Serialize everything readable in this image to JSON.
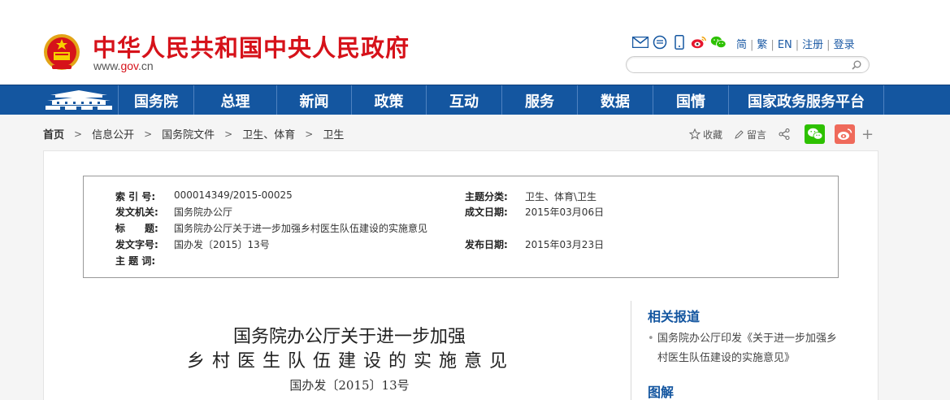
{
  "header": {
    "site_title": "中华人民共和国中央人民政府",
    "site_domain_prefix": "www.",
    "site_domain_main": "gov",
    "site_domain_suffix": ".cn",
    "lang_links": [
      "简",
      "繁",
      "EN",
      "注册",
      "登录"
    ],
    "search_placeholder": "",
    "icons": [
      "mail-icon",
      "message-icon",
      "mobile-icon",
      "weibo-icon",
      "wechat-icon"
    ]
  },
  "nav": {
    "items": [
      "国务院",
      "总理",
      "新闻",
      "政策",
      "互动",
      "服务",
      "数据",
      "国情",
      "国家政务服务平台"
    ]
  },
  "breadcrumb": {
    "items": [
      "首页",
      "信息公开",
      "国务院文件",
      "卫生、体育",
      "卫生"
    ]
  },
  "tools": {
    "favorite_label": "收藏",
    "comment_label": "留言",
    "plus": "+"
  },
  "info": {
    "index_label": "索 引 号:",
    "index_value": "000014349/2015-00025",
    "issuer_label": "发文机关:",
    "issuer_value": "国务院办公厅",
    "title_label": "标　　题:",
    "title_value": "国务院办公厅关于进一步加强乡村医生队伍建设的实施意见",
    "docno_label": "发文字号:",
    "docno_value": "国办发〔2015〕13号",
    "keywords_label": "主 题 词:",
    "keywords_value": "",
    "category_label": "主题分类:",
    "category_value": "卫生、体育\\卫生",
    "created_label": "成文日期:",
    "created_value": "2015年03月06日",
    "published_label": "发布日期:",
    "published_value": "2015年03月23日"
  },
  "article": {
    "title_line1": "国务院办公厅关于进一步加强",
    "title_line2": "乡村医生队伍建设的实施意见",
    "doc_number": "国办发〔2015〕13号"
  },
  "sidebar": {
    "related_title": "相关报道",
    "related_items": [
      "国务院办公厅印发《关于进一步加强乡村医生队伍建设的实施意见》"
    ],
    "bullet": "•",
    "graphics_title": "图解"
  },
  "colors": {
    "brand_red": "#d6121a",
    "nav_blue": "#1456a0",
    "wechat_green": "#2dc100",
    "weibo_red": "#e6162d"
  }
}
